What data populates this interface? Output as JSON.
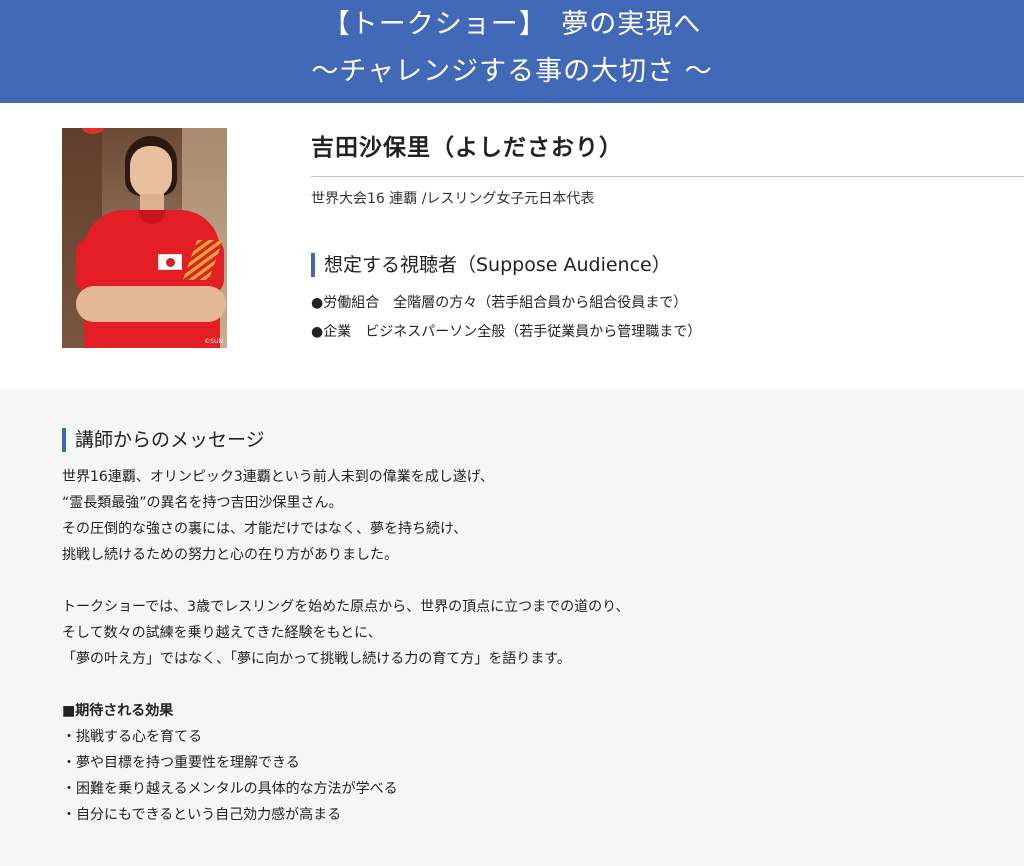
{
  "header": {
    "line1": "【トークショー】　夢の実現へ",
    "line2": "～チャレンジする事の大切さ ～"
  },
  "profile": {
    "photo_credit": "©SUN",
    "name": "吉田沙保里（よしださおり）",
    "title": "世界大会16 連覇 /レスリング女子元日本代表",
    "audience_heading": "想定する視聴者（Suppose Audience）",
    "audience_items": [
      "●労働組合　全階層の方々（若手組合員から組合役員まで）",
      "●企業　ビジネスパーソン全般（若手従業員から管理職まで）"
    ]
  },
  "message": {
    "heading": "講師からのメッセージ",
    "paragraph1": [
      "世界16連覇、オリンピック3連覇という前人未到の偉業を成し遂げ、",
      "“霊長類最強”の異名を持つ吉田沙保里さん。",
      "その圧倒的な強さの裏には、才能だけではなく、夢を持ち続け、",
      "挑戦し続けるための努力と心の在り方がありました。"
    ],
    "paragraph2": [
      "トークショーでは、3歳でレスリングを始めた原点から、世界の頂点に立つまでの道のり、",
      "そして数々の試練を乗り越えてきた経験をもとに、",
      "「夢の叶え方」ではなく、「夢に向かって挑戦し続ける力の育て方」を語ります。"
    ],
    "effects_title": "■期待される効果",
    "effects": [
      "・挑戦する心を育てる",
      "・夢や目標を持つ重要性を理解できる",
      "・困難を乗り越えるメンタルの具体的な方法が学べる",
      "・自分にもできるという自己効力感が高まる"
    ]
  },
  "colors": {
    "header_bg": "#4169b7",
    "accent_bar": "#4169b7",
    "message_bg": "#f6f6f6"
  }
}
